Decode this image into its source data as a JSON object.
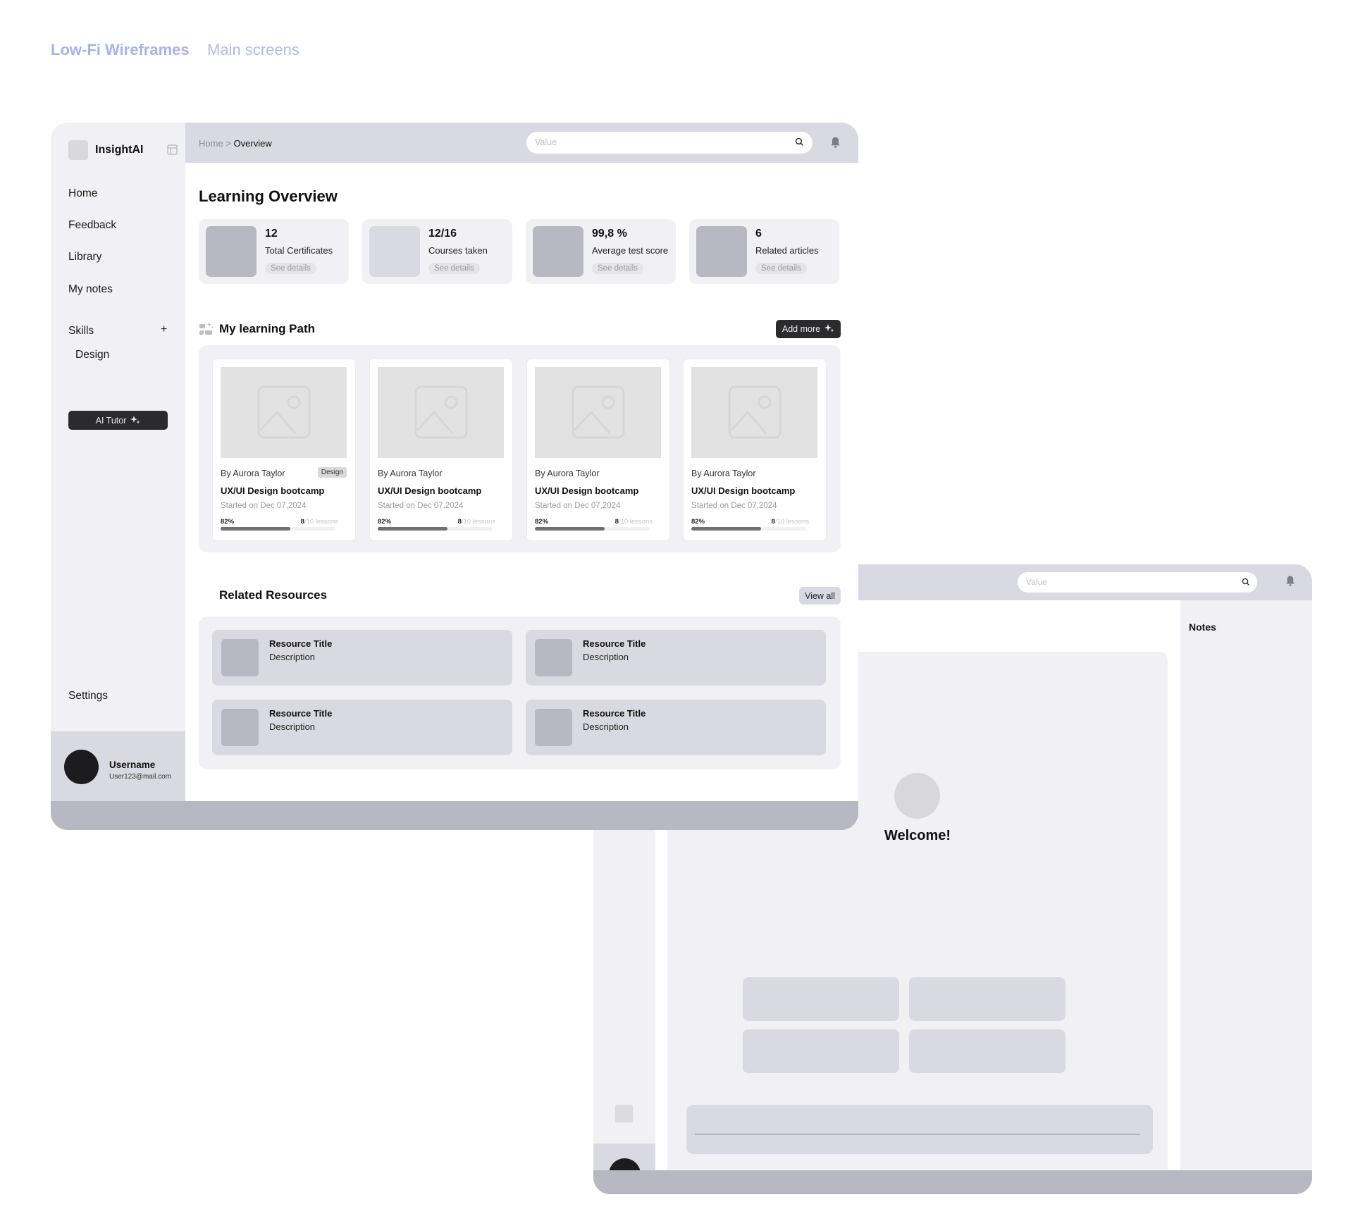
{
  "page": {
    "heading": "Low-Fi Wireframes",
    "subheading": "Main screens"
  },
  "overview_screen": {
    "app_name": "InsightAI",
    "breadcrumb": {
      "parent": "Home",
      "separator": ">",
      "current": "Overview"
    },
    "search": {
      "placeholder": "Value"
    },
    "sidebar": {
      "nav": [
        {
          "label": "Home"
        },
        {
          "label": "Feedback"
        },
        {
          "label": "Library"
        },
        {
          "label": "My notes"
        }
      ],
      "skills_label": "Skills",
      "skills_add": "+",
      "skills": [
        {
          "label": "Design"
        }
      ],
      "ai_tutor_label": "AI Tutor",
      "settings_label": "Settings",
      "user": {
        "name": "Username",
        "email": "User123@mail.com"
      }
    },
    "title": "Learning Overview",
    "stats": [
      {
        "value": "12",
        "label": "Total Certificates",
        "action": "See details"
      },
      {
        "value": "12/16",
        "label": "Courses taken",
        "action": "See details"
      },
      {
        "value": "99,8 %",
        "label": "Average test score",
        "action": "See details"
      },
      {
        "value": "6",
        "label": "Related articles",
        "action": "See details"
      }
    ],
    "learning_path": {
      "title": "My learning Path",
      "add_more_label": "Add more",
      "courses": [
        {
          "author": "By Aurora Taylor",
          "tag": "Design",
          "title": "UX/UI Design bootcamp",
          "started": "Started on Dec 07,2024",
          "percent_label": "82%",
          "progress": 0.61,
          "lessons_done": "8",
          "lessons_total": "/10 lessons"
        },
        {
          "author": "By Aurora Taylor",
          "tag": "",
          "title": "UX/UI Design bootcamp",
          "started": "Started on Dec 07,2024",
          "percent_label": "82%",
          "progress": 0.61,
          "lessons_done": "8",
          "lessons_total": "/10 lessons"
        },
        {
          "author": "By Aurora Taylor",
          "tag": "",
          "title": "UX/UI Design bootcamp",
          "started": "Started on Dec 07,2024",
          "percent_label": "82%",
          "progress": 0.61,
          "lessons_done": "8",
          "lessons_total": "/10 lessons"
        },
        {
          "author": "By Aurora Taylor",
          "tag": "",
          "title": "UX/UI Design bootcamp",
          "started": "Started on Dec 07,2024",
          "percent_label": "82%",
          "progress": 0.61,
          "lessons_done": "8",
          "lessons_total": "/10 lessons"
        }
      ]
    },
    "resources": {
      "title": "Related Resources",
      "view_all_label": "View all",
      "items": [
        {
          "title": "Resource Title",
          "description": "Description"
        },
        {
          "title": "Resource Title",
          "description": "Description"
        },
        {
          "title": "Resource Title",
          "description": "Description"
        },
        {
          "title": "Resource Title",
          "description": "Description"
        }
      ]
    }
  },
  "tutor_screen": {
    "search": {
      "placeholder": "Value"
    },
    "welcome": "Welcome!",
    "notes_title": "Notes"
  },
  "icons": {
    "search": "search-icon",
    "bell": "bell-icon",
    "sparkle": "sparkle-icon",
    "layout": "sidebar-layout-icon",
    "image_placeholder": "image-placeholder-icon"
  },
  "colors": {
    "heading": "#a8b3e6",
    "panel": "#f1f1f5",
    "header": "#d9d9e1",
    "footer": "#b8b8c3",
    "dark_button": "#2b2b2d",
    "avatar": "#1c1c1e"
  }
}
